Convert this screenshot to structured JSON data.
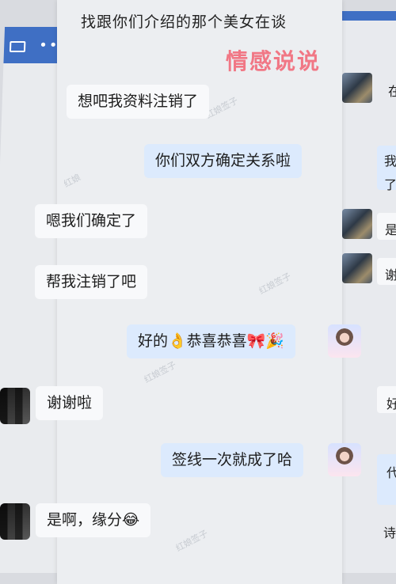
{
  "header": {
    "title": "找跟你们介绍的那个美女在谈"
  },
  "brand": {
    "watermark": "情感说说"
  },
  "left_panel": {
    "icons": [
      "video-icon",
      "more-icon"
    ]
  },
  "messages": [
    {
      "side": "incoming",
      "text": "想吧我资料注销了"
    },
    {
      "side": "outgoing",
      "text": "你们双方确定关系啦"
    },
    {
      "side": "incoming",
      "text": "嗯我们确定了"
    },
    {
      "side": "incoming",
      "text": "帮我注销了吧"
    },
    {
      "side": "outgoing",
      "text": "好的👌恭喜恭喜🎀🎉"
    },
    {
      "side": "incoming",
      "text": "谢谢啦"
    },
    {
      "side": "outgoing",
      "text": "签线一次就成了哈"
    },
    {
      "side": "incoming",
      "text": "是啊，缘分😂"
    }
  ],
  "right_panel": {
    "texts": [
      "在",
      "我",
      "了",
      "是",
      "谢",
      "好",
      "代",
      "诗"
    ]
  },
  "colors": {
    "accent": "#3f6fc4",
    "incoming_bubble": "#f8f9fb",
    "outgoing_bubble": "#dceafd",
    "logo": "#f17785"
  }
}
